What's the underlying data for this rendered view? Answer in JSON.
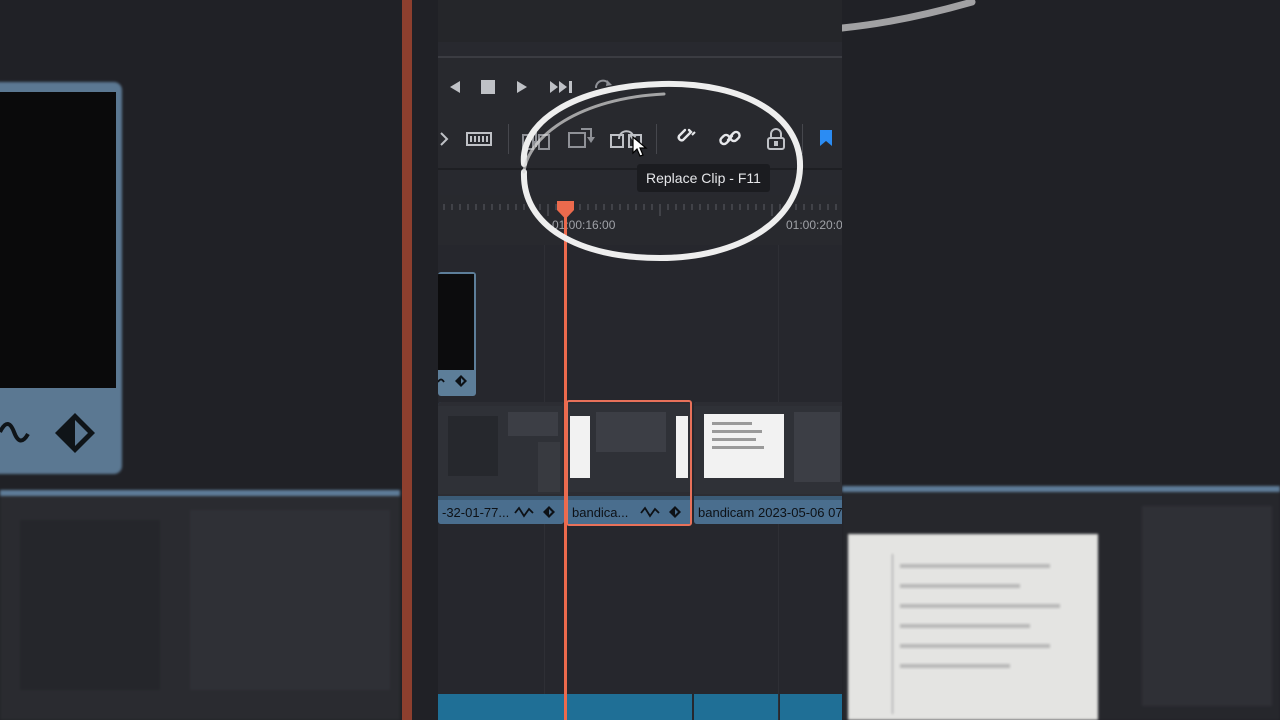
{
  "tooltip": {
    "text": "Replace Clip - F11"
  },
  "ruler": {
    "timecode_1": "01:00:16:00",
    "timecode_2": "01:00:20:0"
  },
  "clips": [
    {
      "label": "-32-01-77..."
    },
    {
      "label": "bandica..."
    },
    {
      "label": "bandicam 2023-05-06 07"
    }
  ],
  "icons": {
    "transport": [
      "prev-icon",
      "stop-icon",
      "play-icon",
      "next-icon",
      "loop-icon"
    ],
    "toolbar": [
      "trim-icon",
      "insert-icon",
      "overwrite-icon",
      "replace-clip-icon",
      "snapping-icon",
      "link-icon",
      "lock-icon",
      "flag-icon"
    ]
  },
  "colors": {
    "playhead": "#ec6a4d",
    "clip": "#4a6e8e",
    "selected_clip_border": "#e8715a",
    "flag": "#2b8cf3"
  }
}
